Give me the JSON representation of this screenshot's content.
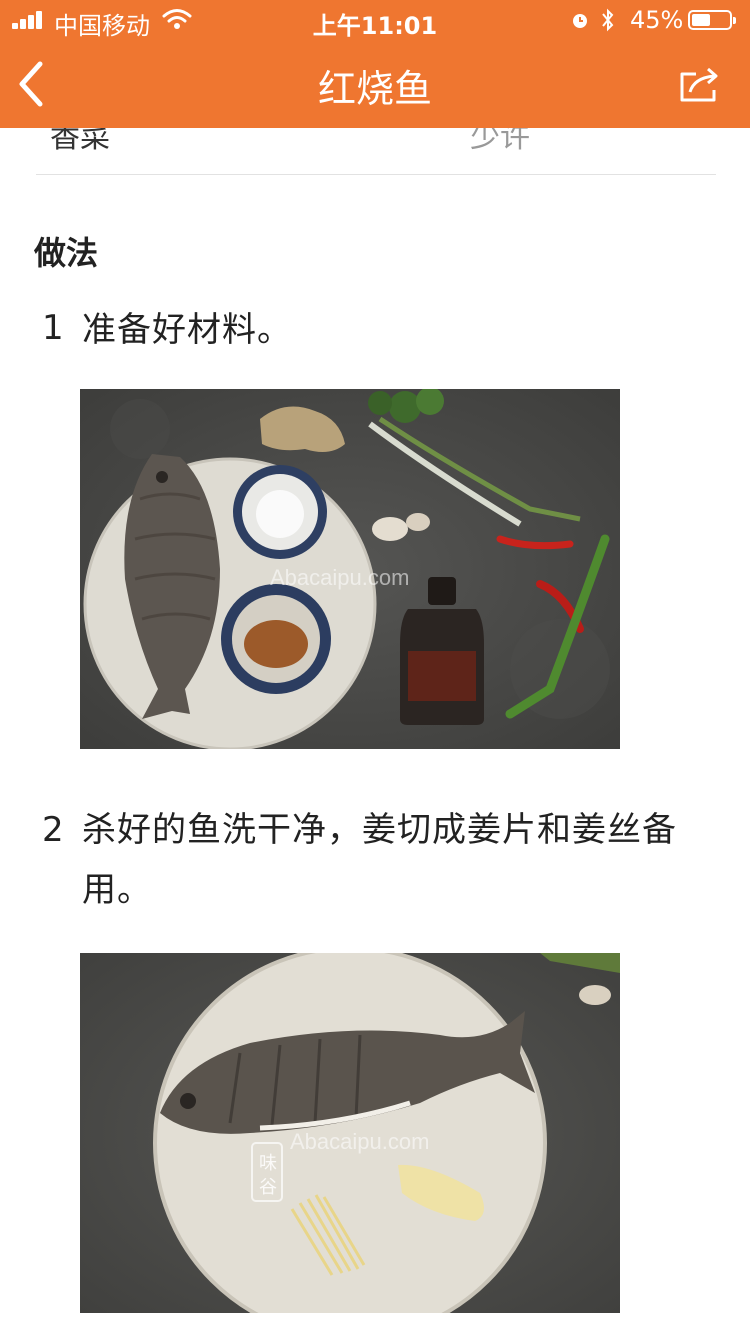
{
  "status_bar": {
    "carrier": "中国移动",
    "time": "上午11:01",
    "battery_percent": "45%",
    "battery_level": 0.45
  },
  "nav": {
    "title": "红烧鱼",
    "back_icon": "chevron-left-icon",
    "share_icon": "share-icon"
  },
  "ingredients_tail": {
    "name": "香菜",
    "amount": "少许"
  },
  "method": {
    "heading": "做法",
    "steps": [
      {
        "number": "1",
        "text": "准备好材料。",
        "watermark": "Abacaipu.com"
      },
      {
        "number": "2",
        "text": "杀好的鱼洗干净，姜切成姜片和姜丝备用。",
        "watermark": "Abacaipu.com",
        "seal": "味谷"
      }
    ]
  },
  "colors": {
    "accent": "#ef7630",
    "text": "#222222",
    "muted": "#999999"
  }
}
